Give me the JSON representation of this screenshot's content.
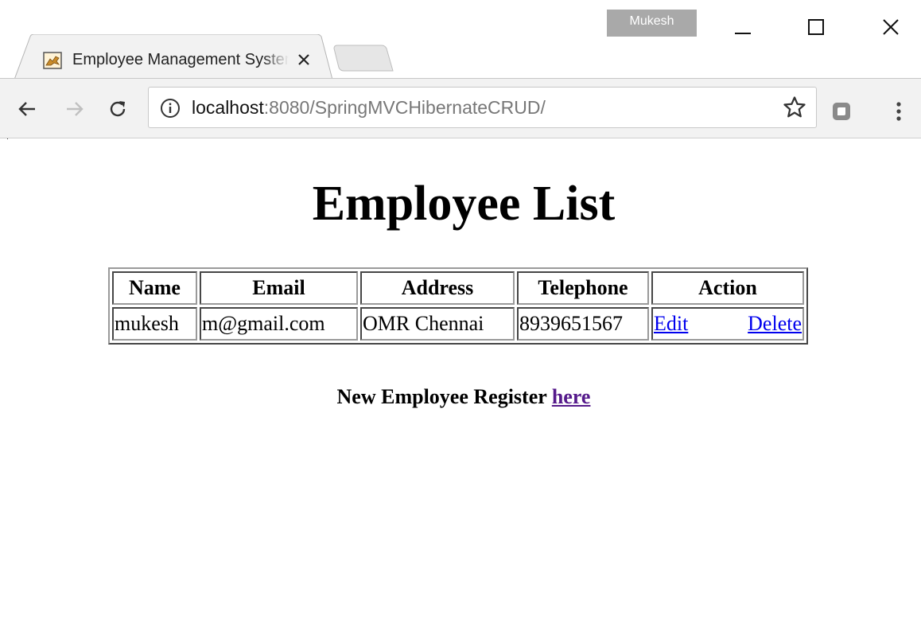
{
  "window": {
    "profile_name": "Mukesh",
    "controls": [
      "minimize-icon",
      "maximize-icon",
      "close-icon"
    ]
  },
  "tab": {
    "title": "Employee Management System",
    "favicon": "tomcat-icon",
    "close_icon": "close-icon"
  },
  "toolbar": {
    "url_host": "localhost",
    "url_rest": ":8080/SpringMVCHibernateCRUD/",
    "icons": [
      "back-icon",
      "forward-icon",
      "reload-icon",
      "info-icon",
      "star-icon",
      "extension-icon",
      "menu-icon"
    ]
  },
  "page": {
    "title": "Employee List",
    "table": {
      "headers": [
        "Name",
        "Email",
        "Address",
        "Telephone",
        "Action"
      ],
      "rows": [
        {
          "name": "mukesh",
          "email": "m@gmail.com",
          "address": "OMR Chennai",
          "telephone": "8939651567",
          "edit_label": "Edit",
          "delete_label": "Delete"
        }
      ]
    },
    "register_text": "New Employee Register",
    "register_link": "here"
  },
  "colors": {
    "link": "#0000ee",
    "visited_link": "#551a8b",
    "profile_badge": "#a9a9a9",
    "toolbar_bg": "#f2f2f2"
  }
}
